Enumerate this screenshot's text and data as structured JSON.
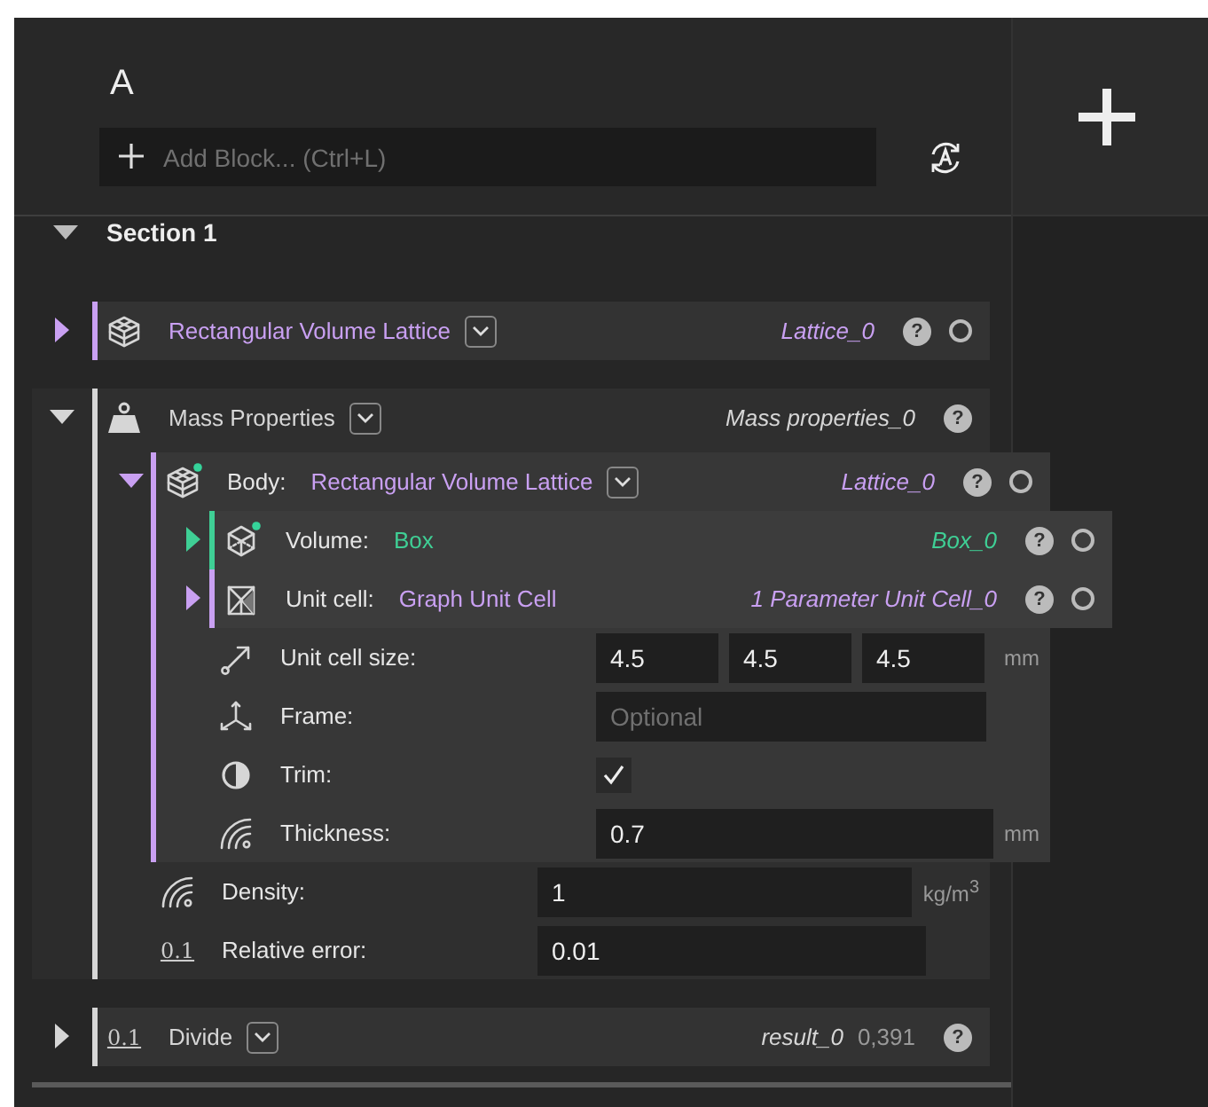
{
  "panel": {
    "title": "A",
    "add_block": {
      "placeholder": "Add Block... (Ctrl+L)"
    }
  },
  "section": {
    "label": "Section 1",
    "expanded": true,
    "blocks": [
      {
        "kind": "lattice",
        "label": "Rectangular Volume Lattice",
        "dropdown": true,
        "output": "Lattice_0",
        "expanded": false,
        "color": "#c9a0f2",
        "help": "?",
        "toggle": true
      },
      {
        "kind": "mass",
        "label": "Mass Properties",
        "dropdown": true,
        "output": "Mass properties_0",
        "expanded": true,
        "color": "#d6d6d6",
        "help": "?",
        "inputs": [
          {
            "kind": "lattice",
            "label": "Body:",
            "value": "Rectangular Volume Lattice",
            "dropdown": true,
            "output": "Lattice_0",
            "expanded": true,
            "modified": true,
            "color": "#c9a0f2",
            "help": "?",
            "toggle": true,
            "inputs": [
              {
                "kind": "box",
                "label": "Volume:",
                "value": "Box",
                "output": "Box_0",
                "expanded": false,
                "modified": true,
                "color": "#3fcf95",
                "help": "?",
                "toggle": true
              },
              {
                "kind": "unitcell",
                "label": "Unit cell:",
                "value": "Graph Unit Cell",
                "output": "1 Parameter Unit Cell_0",
                "expanded": false,
                "modified": false,
                "color": "#c9a0f2",
                "help": "?",
                "toggle": true
              },
              {
                "kind": "vector",
                "label": "Unit cell size:",
                "values": [
                  "4.5",
                  "4.5",
                  "4.5"
                ],
                "unit": "mm"
              },
              {
                "kind": "frame",
                "label": "Frame:",
                "placeholder": "Optional"
              },
              {
                "kind": "checkbox",
                "label": "Trim:",
                "checked": true
              },
              {
                "kind": "number",
                "label": "Thickness:",
                "value": "0.7",
                "unit": "mm"
              }
            ]
          },
          {
            "kind": "number",
            "label": "Density:",
            "value": "1",
            "unit": "kg/m$^{3}$"
          },
          {
            "kind": "scalar",
            "badge": "0.1",
            "label": "Relative error:",
            "value": "0.01"
          }
        ]
      },
      {
        "kind": "divide",
        "badge": "0.1",
        "label": "Divide",
        "dropdown": true,
        "output": "result_0",
        "result": "0,391",
        "expanded": false,
        "color": "#d6d6d6",
        "help": "?"
      }
    ]
  }
}
